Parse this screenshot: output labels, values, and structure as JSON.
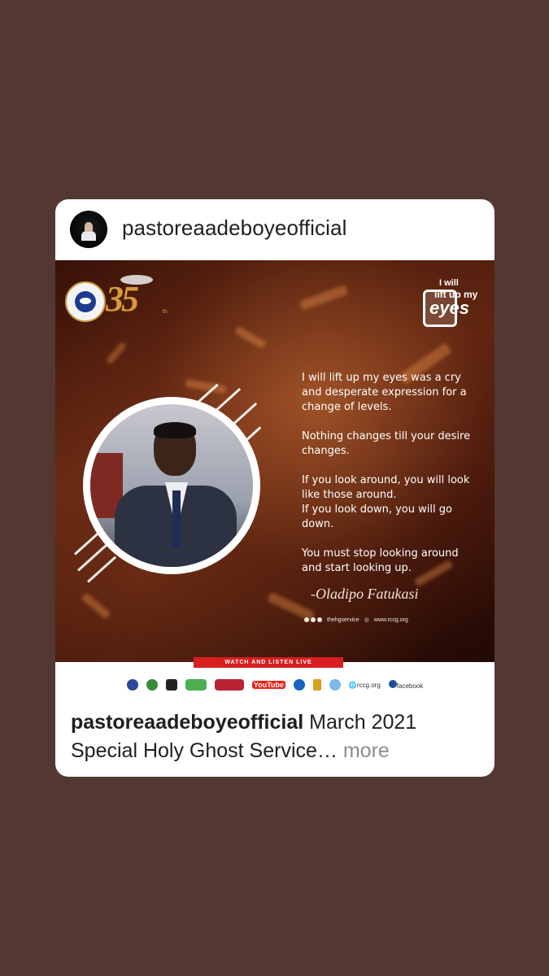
{
  "post": {
    "username": "pastoreaadeboyeofficial",
    "caption_username": "pastoreaadeboyeofficial",
    "caption_text": "March 2021 Special Holy Ghost Service",
    "caption_ellipsis": "…",
    "more_label": "more"
  },
  "flyer": {
    "anniversary_number": "35",
    "anniversary_suffix": "th",
    "badge_line1": "I will",
    "badge_line2": "lift up my",
    "badge_line3": "eyes",
    "quote_paragraphs": [
      "I will lift up my eyes was a cry and desperate expression for a change of levels.",
      "Nothing changes till your desire changes.",
      "If you look around, you will look like those around.",
      "If you look down, you will go down.",
      "You must stop looking around and start looking up."
    ],
    "signature": "-Oladipo Fatukasi",
    "social_handle": "thehgservice",
    "website": "www.rccg.org",
    "watch_label": "WATCH AND LISTEN LIVE",
    "stream_logos": [
      "YouTube",
      "rccg.org",
      "facebook"
    ]
  }
}
